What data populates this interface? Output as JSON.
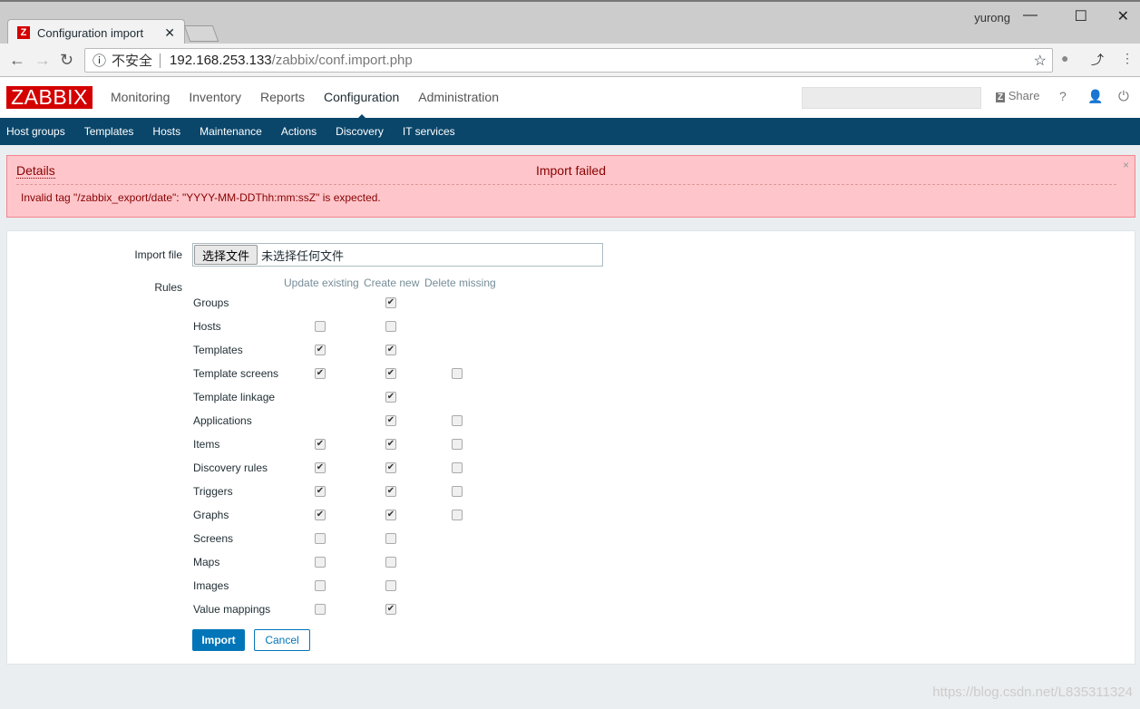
{
  "browser": {
    "tab_title": "Configuration import",
    "user": "yurong",
    "security": "不安全",
    "url_host": "192.168.253.133",
    "url_path": "/zabbix/conf.import.php"
  },
  "header": {
    "logo": "ZABBIX",
    "menu": [
      "Monitoring",
      "Inventory",
      "Reports",
      "Configuration",
      "Administration"
    ],
    "active": "Configuration",
    "share": "Share",
    "help": "?"
  },
  "subnav": [
    "Host groups",
    "Templates",
    "Hosts",
    "Maintenance",
    "Actions",
    "Discovery",
    "IT services"
  ],
  "message": {
    "details": "Details",
    "title": "Import failed",
    "text": "Invalid tag \"/zabbix_export/date\": \"YYYY-MM-DDThh:mm:ssZ\" is expected.",
    "close": "×"
  },
  "form": {
    "import_file_label": "Import file",
    "choose_button": "选择文件",
    "no_file": "未选择任何文件",
    "rules_label": "Rules",
    "columns": [
      "Update existing",
      "Create new",
      "Delete missing"
    ],
    "rules": [
      {
        "name": "Groups",
        "update": null,
        "create": true,
        "delete": null
      },
      {
        "name": "Hosts",
        "update": false,
        "create": false,
        "delete": null
      },
      {
        "name": "Templates",
        "update": true,
        "create": true,
        "delete": null
      },
      {
        "name": "Template screens",
        "update": true,
        "create": true,
        "delete": false
      },
      {
        "name": "Template linkage",
        "update": null,
        "create": true,
        "delete": null
      },
      {
        "name": "Applications",
        "update": null,
        "create": true,
        "delete": false
      },
      {
        "name": "Items",
        "update": true,
        "create": true,
        "delete": false
      },
      {
        "name": "Discovery rules",
        "update": true,
        "create": true,
        "delete": false
      },
      {
        "name": "Triggers",
        "update": true,
        "create": true,
        "delete": false
      },
      {
        "name": "Graphs",
        "update": true,
        "create": true,
        "delete": false
      },
      {
        "name": "Screens",
        "update": false,
        "create": false,
        "delete": null
      },
      {
        "name": "Maps",
        "update": false,
        "create": false,
        "delete": null
      },
      {
        "name": "Images",
        "update": false,
        "create": false,
        "delete": null
      },
      {
        "name": "Value mappings",
        "update": false,
        "create": true,
        "delete": null
      }
    ],
    "import_button": "Import",
    "cancel_button": "Cancel"
  },
  "watermark": "https://blog.csdn.net/L835311324"
}
